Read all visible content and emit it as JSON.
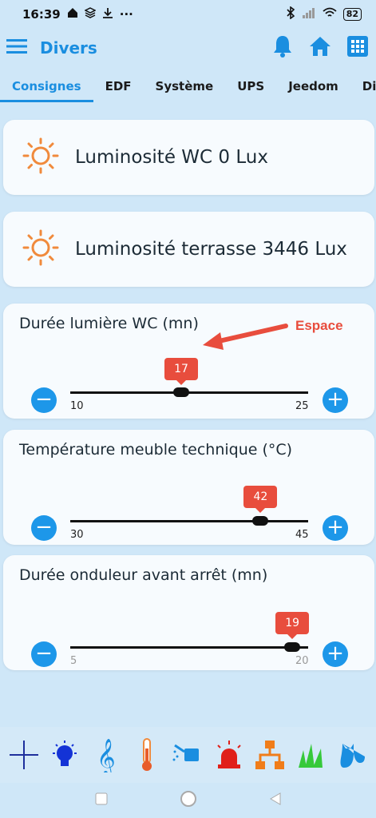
{
  "status": {
    "time": "16:39",
    "battery": "82"
  },
  "appbar": {
    "title": "Divers",
    "menu_icon": "hamburger-icon",
    "icons": [
      "bell-icon",
      "home-icon",
      "grid-icon"
    ]
  },
  "tabs": [
    {
      "label": "Consignes",
      "active": true
    },
    {
      "label": "EDF",
      "active": false
    },
    {
      "label": "Système",
      "active": false
    },
    {
      "label": "UPS",
      "active": false
    },
    {
      "label": "Jeedom",
      "active": false
    },
    {
      "label": "Diver",
      "active": false
    }
  ],
  "info_cards": [
    {
      "label": "Luminosité WC 0 Lux",
      "icon": "sun-icon"
    },
    {
      "label": "Luminosité terrasse 3446 Lux",
      "icon": "sun-icon"
    }
  ],
  "sliders": [
    {
      "label": "Durée lumière WC (mn)",
      "min": 10,
      "max": 25,
      "value": 17,
      "minText": "10",
      "maxText": "25",
      "valueText": "17",
      "muted": false
    },
    {
      "label": "Température meuble technique (°C)",
      "min": 30,
      "max": 45,
      "value": 42,
      "minText": "30",
      "maxText": "45",
      "valueText": "42",
      "muted": false
    },
    {
      "label": "Durée onduleur avant arrêt (mn)",
      "min": 5,
      "max": 20,
      "value": 19,
      "minText": "5",
      "maxText": "20",
      "valueText": "19",
      "muted": true
    }
  ],
  "annotation": {
    "text": "Espace"
  },
  "controls": {
    "minus": "−",
    "plus": "+"
  },
  "bottom_icons": [
    "plus-cross-icon",
    "lightbulb-icon",
    "treble-clef-icon",
    "thermometer-icon",
    "watering-can-icon",
    "alarm-light-icon",
    "network-icon",
    "grass-icon",
    "cat-icon"
  ],
  "colors": {
    "accent": "#1a8ee0",
    "bubble": "#e84d3d",
    "sun": "#f08a3c",
    "background": "#cfe7f8"
  }
}
